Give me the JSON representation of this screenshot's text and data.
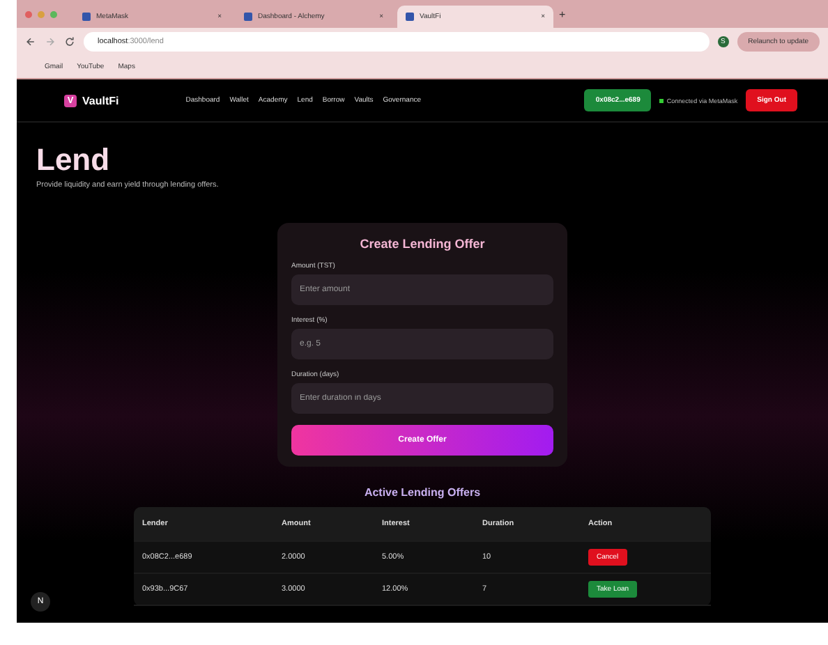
{
  "browser": {
    "tabs": [
      {
        "title": "MetaMask",
        "close": "×",
        "selected": false
      },
      {
        "title": "Dashboard - Alchemy",
        "close": "×",
        "selected": false
      },
      {
        "title": "VaultFi",
        "close": "×",
        "selected": true
      }
    ],
    "new_tab": "+",
    "url_host": "localhost",
    "url_path": ":3000/lend",
    "update_button": "Relaunch to update",
    "profile": "S",
    "bookmarks": [
      {
        "label": "Gmail"
      },
      {
        "label": "YouTube"
      },
      {
        "label": "Maps"
      }
    ]
  },
  "nav": {
    "logo_letter": "V",
    "brand": "VaultFi",
    "links": [
      {
        "label": "Dashboard"
      },
      {
        "label": "Wallet"
      },
      {
        "label": "Academy"
      },
      {
        "label": "Lend"
      },
      {
        "label": "Borrow"
      },
      {
        "label": "Vaults"
      },
      {
        "label": "Governance"
      }
    ],
    "address": "0x08c2...e689",
    "connected": "Connected via MetaMask",
    "sign_out": "Sign Out"
  },
  "page": {
    "title": "Lend",
    "subtitle": "Provide liquidity and earn yield through lending offers."
  },
  "form": {
    "title": "Create Lending Offer",
    "fields": [
      {
        "label": "Amount (TST)",
        "placeholder": "Enter amount"
      },
      {
        "label": "Interest (%)",
        "placeholder": "e.g. 5"
      },
      {
        "label": "Duration (days)",
        "placeholder": "Enter duration in days"
      }
    ],
    "submit": "Create Offer"
  },
  "offers": {
    "title": "Active Lending Offers",
    "columns": [
      "Lender",
      "Amount",
      "Interest",
      "Duration",
      "Action"
    ],
    "rows": [
      {
        "lender": "0x08C2...e689",
        "amount": "2.0000",
        "interest": "5.00%",
        "duration": "10",
        "action": "Cancel",
        "kind": "cancel"
      },
      {
        "lender": "0x93b...9C67",
        "amount": "3.0000",
        "interest": "12.00%",
        "duration": "7",
        "action": "Take Loan",
        "kind": "take"
      }
    ]
  },
  "dev_badge": "N"
}
